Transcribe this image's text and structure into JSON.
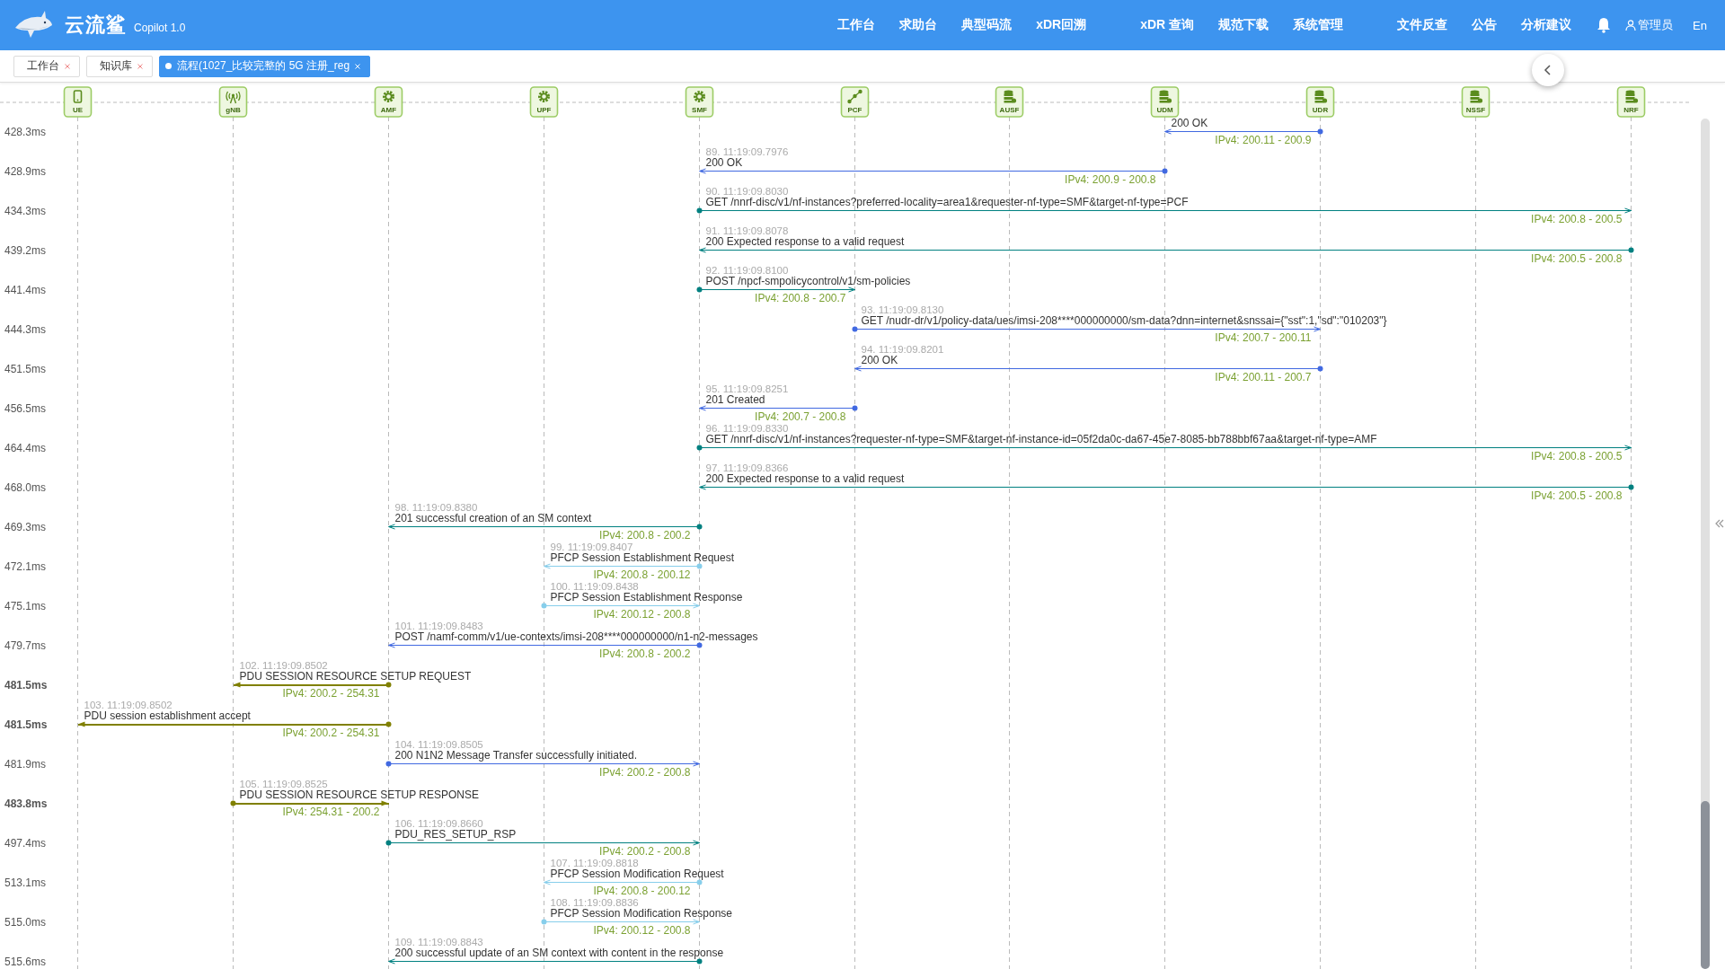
{
  "header": {
    "title": "云流鲨",
    "version": "Copilot 1.0",
    "nav_groups": [
      [
        {
          "label": "工作台"
        },
        {
          "label": "求助台"
        },
        {
          "label": "典型码流"
        },
        {
          "label": "xDR回溯"
        }
      ],
      [
        {
          "label": "xDR 查询"
        },
        {
          "label": "规范下载"
        },
        {
          "label": "系统管理"
        }
      ],
      [
        {
          "label": "文件反查"
        },
        {
          "label": "公告"
        },
        {
          "label": "分析建议"
        }
      ]
    ],
    "user": "管理员",
    "language": "En"
  },
  "tabs": [
    {
      "label": "工作台",
      "selected": false
    },
    {
      "label": "知识库",
      "selected": false
    },
    {
      "label": "流程(1027_比较完整的 5G 注册_reg",
      "selected": true
    }
  ],
  "nodes": [
    {
      "label": "UE",
      "kind": "phone"
    },
    {
      "label": "gNB",
      "kind": "antenna"
    },
    {
      "label": "AMF",
      "kind": "gear"
    },
    {
      "label": "UPF",
      "kind": "gear"
    },
    {
      "label": "SMF",
      "kind": "gear"
    },
    {
      "label": "PCF",
      "kind": "network"
    },
    {
      "label": "AUSF",
      "kind": "database"
    },
    {
      "label": "UDM",
      "kind": "database"
    },
    {
      "label": "UDR",
      "kind": "database"
    },
    {
      "label": "NSSF",
      "kind": "database"
    },
    {
      "label": "NRF",
      "kind": "database"
    }
  ],
  "messages": [
    {
      "time": "428.3ms",
      "text": "200 OK",
      "ip": "IPv4: 200.11 - 200.9",
      "kind": "http",
      "color": "#4169e1"
    },
    {
      "time": "428.9ms",
      "seq": "89. 11:19:09.7976",
      "text": "200 OK",
      "ip": "IPv4: 200.9 - 200.8",
      "kind": "http",
      "color": "#4169e1"
    },
    {
      "time": "434.3ms",
      "seq": "90. 11:19:09.8030",
      "text": "GET /nnrf-disc/v1/nf-instances?preferred-locality=area1&requester-nf-type=SMF&target-nf-type=PCF",
      "ip": "IPv4: 200.8 - 200.5",
      "kind": "http",
      "color": "#008080"
    },
    {
      "time": "439.2ms",
      "seq": "91. 11:19:09.8078",
      "text": "200 Expected response to a valid request",
      "ip": "IPv4: 200.5 - 200.8",
      "kind": "http",
      "color": "#008080"
    },
    {
      "time": "441.4ms",
      "seq": "92. 11:19:09.8100",
      "text": "POST /npcf-smpolicycontrol/v1/sm-policies",
      "ip": "IPv4: 200.8 - 200.7",
      "kind": "http",
      "color": "#008080"
    },
    {
      "time": "444.3ms",
      "seq": "93. 11:19:09.8130",
      "text": "GET /nudr-dr/v1/policy-data/ues/imsi-208****000000000/sm-data?dnn=internet&snssai={\"sst\":1,\"sd\":\"010203\"}",
      "ip": "IPv4: 200.7 - 200.11",
      "kind": "http",
      "color": "#4169e1"
    },
    {
      "time": "451.5ms",
      "seq": "94. 11:19:09.8201",
      "text": "200 OK",
      "ip": "IPv4: 200.11 - 200.7",
      "kind": "http",
      "color": "#4169e1"
    },
    {
      "time": "456.5ms",
      "seq": "95. 11:19:09.8251",
      "text": "201 Created",
      "ip": "IPv4: 200.7 - 200.8",
      "kind": "http",
      "color": "#4169e1"
    },
    {
      "time": "464.4ms",
      "seq": "96. 11:19:09.8330",
      "text": "GET /nnrf-disc/v1/nf-instances?requester-nf-type=SMF&target-nf-instance-id=05f2da0c-da67-45e7-8085-bb788bbf67aa&target-nf-type=AMF",
      "ip": "IPv4: 200.8 - 200.5",
      "kind": "http",
      "color": "#008080"
    },
    {
      "time": "468.0ms",
      "seq": "97. 11:19:09.8366",
      "text": "200 Expected response to a valid request",
      "ip": "IPv4: 200.5 - 200.8",
      "kind": "http",
      "color": "#008080"
    },
    {
      "time": "469.3ms",
      "seq": "98. 11:19:09.8380",
      "text": "201 successful creation of an SM context",
      "ip": "IPv4: 200.8 - 200.2",
      "kind": "http",
      "color": "#008080"
    },
    {
      "time": "472.1ms",
      "seq": "99. 11:19:09.8407",
      "text": "PFCP Session Establishment Request",
      "ip": "IPv4: 200.8 - 200.12",
      "kind": "pfcp",
      "color": "#87ceeb"
    },
    {
      "time": "475.1ms",
      "seq": "100. 11:19:09.8438",
      "text": "PFCP Session Establishment Response",
      "ip": "IPv4: 200.12 - 200.8",
      "kind": "pfcp",
      "color": "#87ceeb"
    },
    {
      "time": "479.7ms",
      "seq": "101. 11:19:09.8483",
      "text": "POST /namf-comm/v1/ue-contexts/imsi-208****000000000/n1-n2-messages",
      "ip": "IPv4: 200.8 - 200.2",
      "kind": "http",
      "color": "#4169e1"
    },
    {
      "time": "481.5ms",
      "seq": "102. 11:19:09.8502",
      "text": "PDU SESSION RESOURCE SETUP REQUEST",
      "ip": "IPv4: 200.2 - 254.31",
      "kind": "ngap",
      "color": "#808000"
    },
    {
      "time": "481.5ms",
      "seq": "103. 11:19:09.8502",
      "text": "PDU session establishment accept",
      "ip": "IPv4: 200.2 - 254.31",
      "kind": "ngap",
      "color": "#808000"
    },
    {
      "time": "481.9ms",
      "seq": "104. 11:19:09.8505",
      "text": "200 N1N2 Message Transfer successfully initiated.",
      "ip": "IPv4: 200.2 - 200.8",
      "kind": "http",
      "color": "#4169e1"
    },
    {
      "time": "483.8ms",
      "seq": "105. 11:19:09.8525",
      "text": "PDU SESSION RESOURCE SETUP RESPONSE",
      "ip": "IPv4: 254.31 - 200.2",
      "kind": "ngap",
      "color": "#808000"
    },
    {
      "time": "497.4ms",
      "seq": "106. 11:19:09.8660",
      "text": "PDU_RES_SETUP_RSP",
      "ip": "IPv4: 200.2 - 200.8",
      "kind": "http",
      "color": "#008080"
    },
    {
      "time": "513.1ms",
      "seq": "107. 11:19:09.8818",
      "text": "PFCP Session Modification Request",
      "ip": "IPv4: 200.8 - 200.12",
      "kind": "pfcp",
      "color": "#87ceeb"
    },
    {
      "time": "515.0ms",
      "seq": "108. 11:19:09.8836",
      "text": "PFCP Session Modification Response",
      "ip": "IPv4: 200.12 - 200.8",
      "kind": "pfcp",
      "color": "#87ceeb"
    },
    {
      "time": "515.6ms",
      "seq": "109. 11:19:09.8843",
      "text": "200 successful update of an SM context with content in the response",
      "kind": "http",
      "color": "#008080"
    }
  ]
}
